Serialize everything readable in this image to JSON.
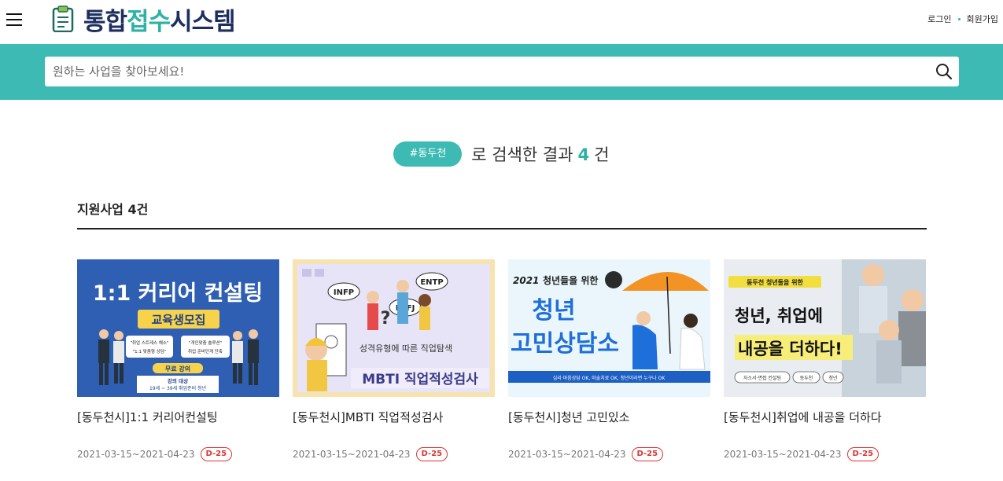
{
  "header": {
    "logo": {
      "part1": "통합",
      "part2": "접수",
      "part3": "시스템"
    },
    "login_label": "로그인",
    "signup_label": "회원가입"
  },
  "search": {
    "placeholder": "원하는 사업을 찾아보세요!",
    "value": ""
  },
  "result": {
    "tag": "#동두천",
    "prefix": "로 검색한 결과",
    "count": "4",
    "suffix": "건"
  },
  "section": {
    "title": "지원사업 4건"
  },
  "cards": [
    {
      "title": "[동두천시]1:1 커리어컨설팅",
      "date": "2021-03-15~2021-04-23",
      "dday": "D-25",
      "thumb": {
        "headline": "1:1 커리어 컨설팅",
        "badge": "교육생모집",
        "bubble1": "\"취업 스트레스 해소\"",
        "bubble2": "\"개인맞춤 솔루션\"",
        "bubble3": "\"1:1 맞춤형 상담\"",
        "bubble4": "취업 준비단계 단축",
        "free": "무료 강의",
        "target_label": "강의 대상",
        "target": "19세 ~ 39세 취업준비 청년"
      }
    },
    {
      "title": "[동두천시]MBTI 직업적성검사",
      "date": "2021-03-15~2021-04-23",
      "dday": "D-25",
      "thumb": {
        "type1": "INFP",
        "type2": "ESFJ",
        "type3": "ENTP",
        "caption": "성격유형에 따른 직업탐색",
        "headline": "MBTI 직업적성검사"
      }
    },
    {
      "title": "[동두천시]청년 고민있소",
      "date": "2021-03-15~2021-04-23",
      "dday": "D-25",
      "thumb": {
        "year": "2021",
        "subtitle": "청년들을 위한",
        "line1": "청년",
        "line2": "고민상담소",
        "footer": "심리·마음상담 OK, 미술치료 OK, 청년이라면 누구나 OK"
      }
    },
    {
      "title": "[동두천시]취업에 내공을 더하다",
      "date": "2021-03-15~2021-04-23",
      "dday": "D-25",
      "thumb": {
        "badge": "동두천 청년들을 위한",
        "line1": "청년, 취업에",
        "line2": "내공을 더하다!",
        "chip1": "자소서·면접 컨설팅",
        "chip2": "동두천",
        "chip3": "청년"
      }
    }
  ]
}
